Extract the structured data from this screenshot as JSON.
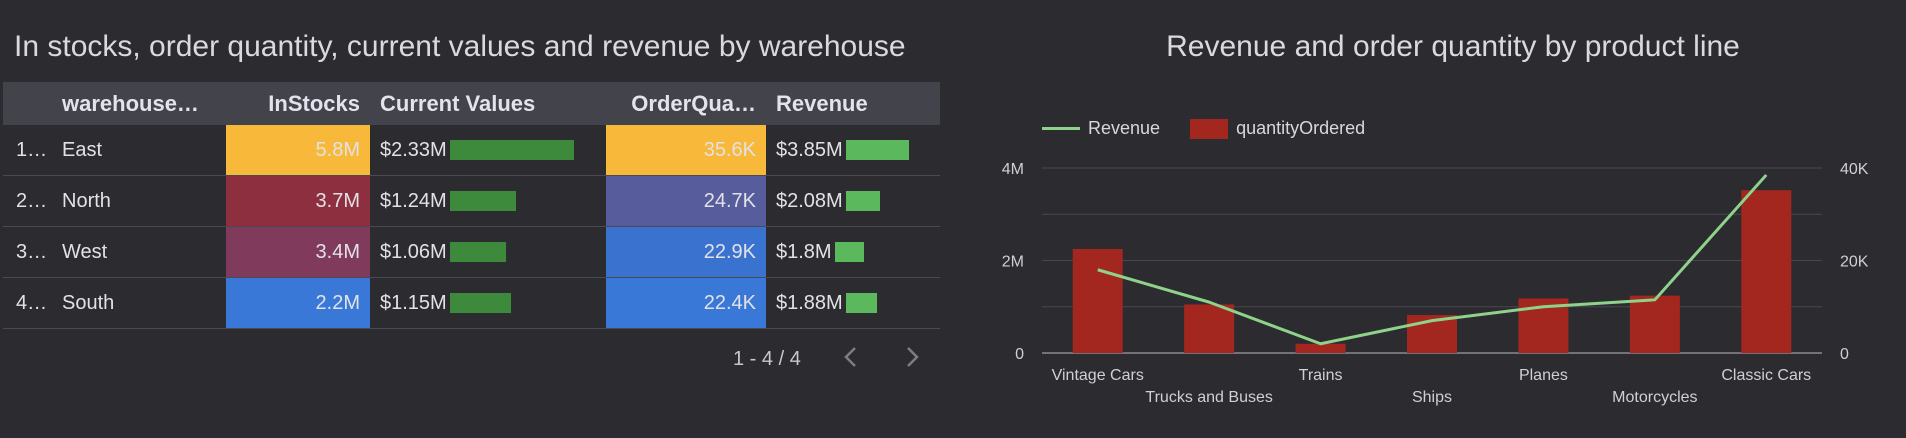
{
  "left_panel": {
    "title": "In stocks, order quantity, current values and revenue by warehouse",
    "columns": [
      "warehouse…",
      "InStocks",
      "Current Values",
      "OrderQua…",
      "Revenue"
    ],
    "rows": [
      {
        "idx": "1…",
        "warehouse": "East",
        "instocks": "5.8M",
        "instocks_color": "#f8b83a",
        "current_values": "$2.33M",
        "current_values_num": 2.33,
        "order_qty": "35.6K",
        "order_qty_color": "#f8b83a",
        "revenue": "$3.85M",
        "revenue_num": 3.85
      },
      {
        "idx": "2…",
        "warehouse": "North",
        "instocks": "3.7M",
        "instocks_color": "#8e2f3f",
        "current_values": "$1.24M",
        "current_values_num": 1.24,
        "order_qty": "24.7K",
        "order_qty_color": "#565c9c",
        "revenue": "$2.08M",
        "revenue_num": 2.08
      },
      {
        "idx": "3…",
        "warehouse": "West",
        "instocks": "3.4M",
        "instocks_color": "#7f3a5c",
        "current_values": "$1.06M",
        "current_values_num": 1.06,
        "order_qty": "22.9K",
        "order_qty_color": "#3a72cf",
        "revenue": "$1.8M",
        "revenue_num": 1.8
      },
      {
        "idx": "4…",
        "warehouse": "South",
        "instocks": "2.2M",
        "instocks_color": "#3a78d8",
        "current_values": "$1.15M",
        "current_values_num": 1.15,
        "order_qty": "22.4K",
        "order_qty_color": "#3a78d8",
        "revenue": "$1.88M",
        "revenue_num": 1.88
      }
    ],
    "pagination": {
      "text": "1 - 4 / 4",
      "prev_icon": "chevron-left-icon",
      "next_icon": "chevron-right-icon"
    }
  },
  "chart_data": {
    "type": "bar",
    "title": "Revenue and order quantity by product line",
    "categories": [
      "Vintage Cars",
      "Trucks and Buses",
      "Trains",
      "Ships",
      "Planes",
      "Motorcycles",
      "Classic Cars"
    ],
    "series": [
      {
        "name": "Revenue",
        "type": "line",
        "axis": "left",
        "color": "#8fd28a",
        "values": [
          1800000,
          1100000,
          200000,
          700000,
          1000000,
          1150000,
          3850000
        ]
      },
      {
        "name": "quantityOrdered",
        "type": "bar",
        "axis": "right",
        "color": "#a3271f",
        "values": [
          22500,
          10500,
          2000,
          8200,
          11800,
          12400,
          35200
        ]
      }
    ],
    "y_left": {
      "range": [
        0,
        4000000
      ],
      "ticks": [
        0,
        2000000,
        4000000
      ],
      "tick_labels": [
        "0",
        "2M",
        "4M"
      ]
    },
    "y_right": {
      "range": [
        0,
        40000
      ],
      "ticks": [
        0,
        20000,
        40000
      ],
      "tick_labels": [
        "0",
        "20K",
        "40K"
      ]
    },
    "grid": true,
    "legend": "top-left"
  }
}
